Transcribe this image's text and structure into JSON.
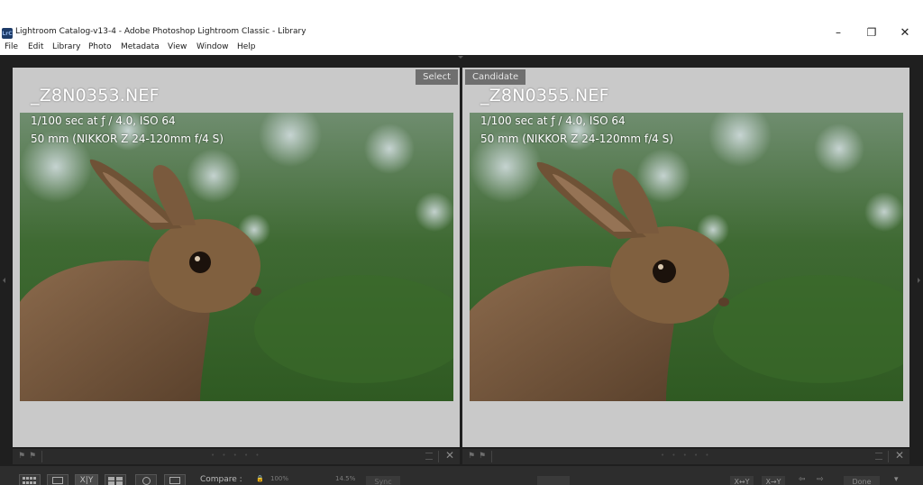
{
  "window": {
    "icon_text": "LrC",
    "title": "Lightroom Catalog-v13-4 - Adobe Photoshop Lightroom Classic - Library",
    "minimize": "–",
    "maximize": "❐",
    "close": "✕"
  },
  "menu": [
    {
      "label": "File"
    },
    {
      "label": "Edit"
    },
    {
      "label": "Library"
    },
    {
      "label": "Photo"
    },
    {
      "label": "Metadata"
    },
    {
      "label": "View"
    },
    {
      "label": "Window"
    },
    {
      "label": "Help"
    }
  ],
  "left_pane": {
    "label": "Select",
    "filename": "_Z8N0353.NEF",
    "exif_line1": "1/100 sec at ƒ / 4.0, ISO 64",
    "exif_line2": "50 mm (NIKKOR Z 24-120mm f/4 S)"
  },
  "right_pane": {
    "label": "Candidate",
    "filename": "_Z8N0355.NEF",
    "exif_line1": "1/100 sec at ƒ / 4.0, ISO 64",
    "exif_line2": "50 mm (NIKKOR Z 24-120mm f/4 S)"
  },
  "toolbar": {
    "compare_view_label": "X|Y",
    "compare_label": "Compare :",
    "zoom_value": "100%",
    "zoom_percent": "14.5%",
    "sync_label": "Sync",
    "swap_label": "X↔Y",
    "make_select_label": "X→Y",
    "done_label": "Done"
  },
  "colors": {
    "workarea": "#1f1f1f",
    "pane_bg": "#c9c9c9",
    "label_bg": "#6f6f6f"
  }
}
